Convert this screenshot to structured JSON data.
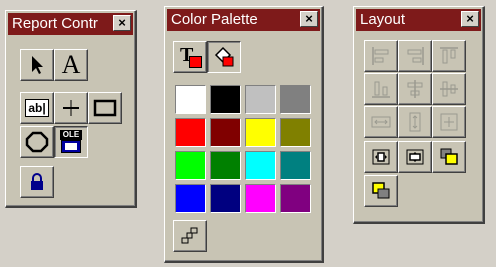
{
  "report_controls": {
    "title": "Report Contr",
    "close_glyph": "×",
    "tools": [
      {
        "name": "pointer-tool-icon"
      },
      {
        "name": "label-tool-icon",
        "glyph": "A"
      },
      {
        "name": "text-box-tool-icon",
        "glyph": "ab|"
      },
      {
        "name": "line-tool-icon"
      },
      {
        "name": "rectangle-tool-icon"
      },
      {
        "name": "rounded-rectangle-tool-icon"
      },
      {
        "name": "ole-bound-tool-icon",
        "glyph": "OLE"
      },
      {
        "name": "button-lock-icon"
      }
    ]
  },
  "color_palette": {
    "title": "Color Palette",
    "close_glyph": "×",
    "mode_buttons": [
      {
        "name": "foreground-color-icon",
        "glyph": "T"
      },
      {
        "name": "fill-color-icon"
      }
    ],
    "swatches": [
      "#ffffff",
      "#000000",
      "#c0c0c0",
      "#808080",
      "#ff0000",
      "#800000",
      "#ffff00",
      "#808000",
      "#00ff00",
      "#008000",
      "#00ffff",
      "#008080",
      "#0000ff",
      "#000080",
      "#ff00ff",
      "#800080"
    ],
    "other_colors_icon": "other-colors-icon"
  },
  "layout": {
    "title": "Layout",
    "close_glyph": "×",
    "tools": [
      {
        "name": "align-left-icon",
        "enabled": false
      },
      {
        "name": "align-right-icon",
        "enabled": false
      },
      {
        "name": "align-top-icon",
        "enabled": false
      },
      {
        "name": "align-bottom-icon",
        "enabled": false
      },
      {
        "name": "align-vertical-center-icon",
        "enabled": false
      },
      {
        "name": "align-horizontal-center-icon",
        "enabled": false
      },
      {
        "name": "same-width-icon",
        "enabled": false
      },
      {
        "name": "same-height-icon",
        "enabled": false
      },
      {
        "name": "same-size-icon",
        "enabled": false
      },
      {
        "name": "center-horizontally-icon",
        "enabled": true
      },
      {
        "name": "center-vertically-icon",
        "enabled": true
      },
      {
        "name": "bring-to-front-icon",
        "enabled": true
      },
      {
        "name": "send-to-back-icon",
        "enabled": true
      }
    ]
  }
}
